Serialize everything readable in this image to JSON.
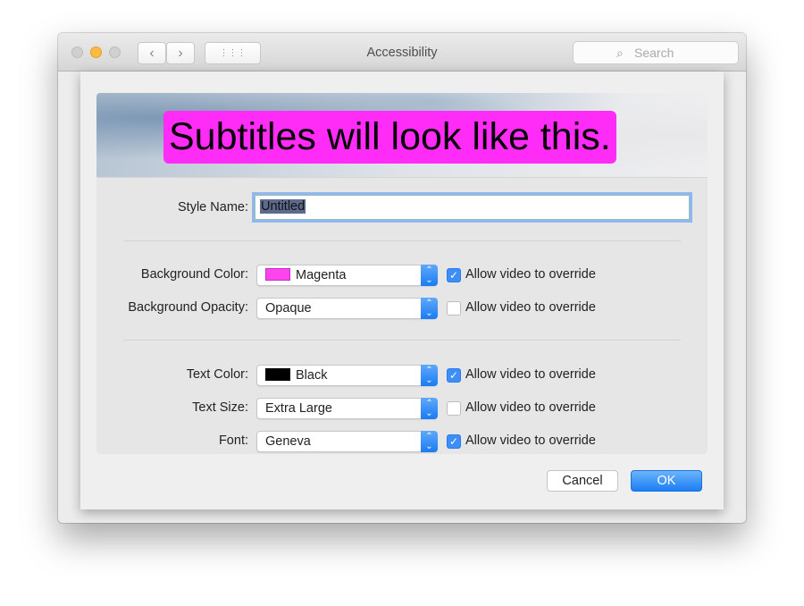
{
  "window": {
    "title": "Accessibility",
    "search_placeholder": "Search",
    "back": "‹",
    "forward": "›",
    "grid": "⋮⋮⋮"
  },
  "preview": {
    "text": "Subtitles will look like this.",
    "background_color": "#ff2cf7"
  },
  "form": {
    "style_name": {
      "label": "Style Name:",
      "value": "Untitled"
    },
    "rows": [
      {
        "label": "Background Color:",
        "value": "Magenta",
        "swatch": "#ff44ee",
        "override_label": "Allow video to override",
        "override": true
      },
      {
        "label": "Background Opacity:",
        "value": "Opaque",
        "override_label": "Allow video to override",
        "override": false
      },
      {
        "label": "Text Color:",
        "value": "Black",
        "swatch": "#000000",
        "override_label": "Allow video to override",
        "override": true
      },
      {
        "label": "Text Size:",
        "value": "Extra Large",
        "override_label": "Allow video to override",
        "override": false
      },
      {
        "label": "Font:",
        "value": "Geneva",
        "override_label": "Allow video to override",
        "override": true
      }
    ]
  },
  "buttons": {
    "cancel": "Cancel",
    "ok": "OK"
  }
}
